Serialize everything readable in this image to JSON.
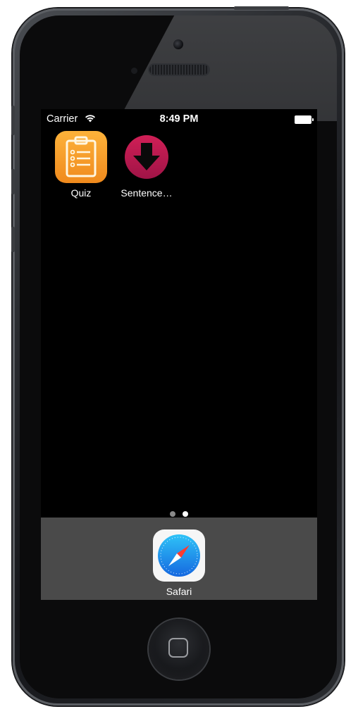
{
  "status_bar": {
    "carrier": "Carrier",
    "time": "8:49 PM",
    "wifi_icon": "wifi-icon",
    "battery_icon": "battery-icon"
  },
  "home_screen": {
    "apps": [
      {
        "label": "Quiz",
        "icon": "clipboard-checklist-icon",
        "color": "#f7a12b"
      },
      {
        "label": "Sentence…",
        "icon": "download-arrow-icon",
        "color": "#c2184b"
      }
    ],
    "page_indicator": {
      "pages": 2,
      "current_page": 2
    }
  },
  "dock": {
    "apps": [
      {
        "label": "Safari",
        "icon": "compass-icon",
        "color": "#1a8cf0"
      }
    ]
  },
  "device": {
    "home_button_icon": "home-square-icon"
  }
}
